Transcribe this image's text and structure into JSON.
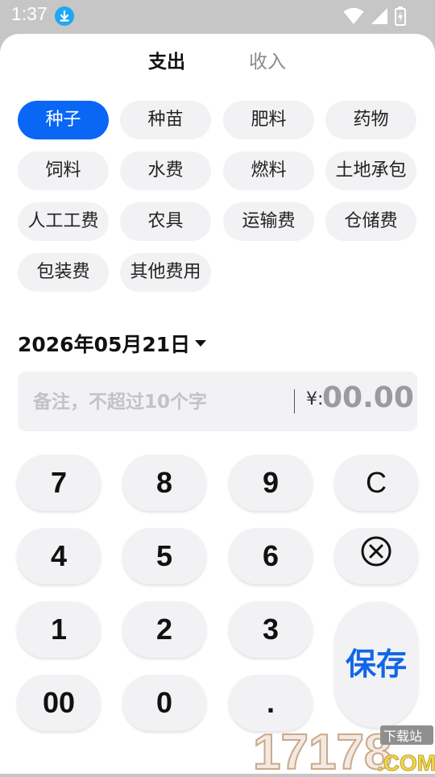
{
  "status": {
    "time": "1:37",
    "icons": [
      "download-icon",
      "wifi-icon",
      "signal-icon",
      "battery-icon"
    ]
  },
  "tabs": [
    {
      "label": "支出",
      "active": true
    },
    {
      "label": "收入",
      "active": false
    }
  ],
  "categories": [
    {
      "label": "种子",
      "selected": true
    },
    {
      "label": "种苗"
    },
    {
      "label": "肥料"
    },
    {
      "label": "药物"
    },
    {
      "label": "饲料"
    },
    {
      "label": "水费"
    },
    {
      "label": "燃料"
    },
    {
      "label": "土地承包"
    },
    {
      "label": "人工工费"
    },
    {
      "label": "农具"
    },
    {
      "label": "运输费"
    },
    {
      "label": "仓储费"
    },
    {
      "label": "包装费"
    },
    {
      "label": "其他费用"
    }
  ],
  "date": "2026年05月21日",
  "note": {
    "placeholder": "备注，不超过10个字",
    "value": ""
  },
  "currency_symbol": "¥:",
  "amount": "00.00",
  "keypad": {
    "k7": "7",
    "k8": "8",
    "k9": "9",
    "clear": "C",
    "k4": "4",
    "k5": "5",
    "k6": "6",
    "k1": "1",
    "k2": "2",
    "k3": "3",
    "k00": "00",
    "k0": "0",
    "dot": ".",
    "save": "保存"
  },
  "watermark": {
    "number": "17178",
    "tag": "下载站",
    "suffix": ".COM"
  },
  "colors": {
    "accent": "#0a66f5",
    "save_text": "#1166e8",
    "chip_bg": "#f2f2f4",
    "status_bar": "#c6c6c6"
  }
}
